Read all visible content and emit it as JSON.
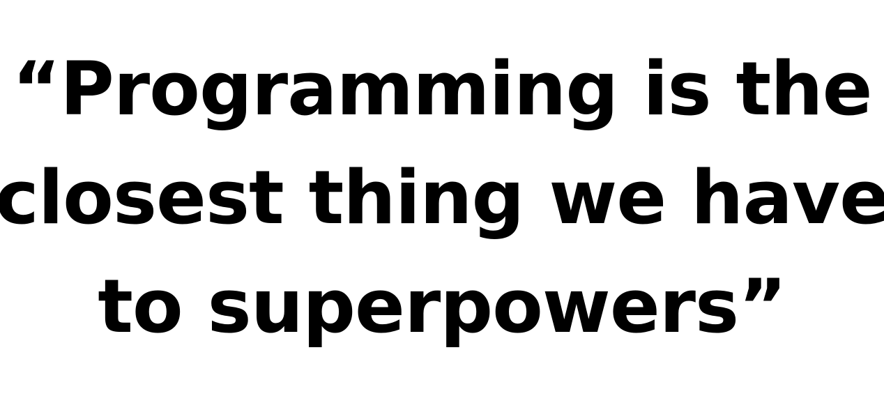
{
  "quote": {
    "lines": [
      "“Programming is the",
      "closest thing we have",
      "to superpowers”"
    ]
  },
  "colors": {
    "background": "#ffffff",
    "text": "#000000"
  }
}
